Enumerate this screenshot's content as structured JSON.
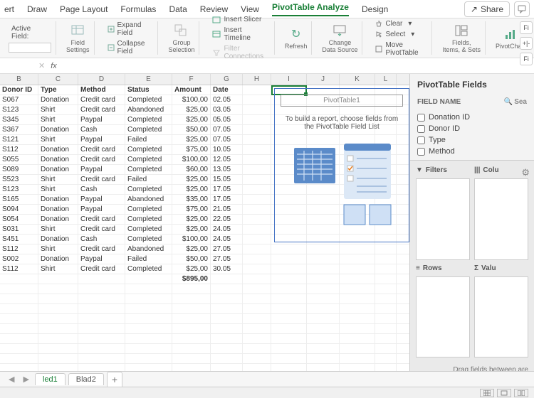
{
  "menu": {
    "items": [
      "ert",
      "Draw",
      "Page Layout",
      "Formulas",
      "Data",
      "Review",
      "View",
      "PivotTable Analyze",
      "Design"
    ],
    "active": "PivotTable Analyze",
    "share": "Share"
  },
  "ribbon": {
    "activeField": "Active Field:",
    "fieldSettings": "Field\nSettings",
    "expand": "Expand Field",
    "collapse": "Collapse Field",
    "groupSel": "Group\nSelection",
    "slicer": "Insert Slicer",
    "timeline": "Insert Timeline",
    "filterConn": "Filter Connections",
    "refresh": "Refresh",
    "changeData": "Change\nData Source",
    "clear": "Clear",
    "select": "Select",
    "move": "Move PivotTable",
    "fieldsItems": "Fields,\nItems, & Sets",
    "pivotChart": "PivotChart",
    "fi1": "Fi",
    "fi2": "Fi"
  },
  "formula": {
    "cell": "",
    "fx": "fx"
  },
  "columns": [
    "B",
    "C",
    "D",
    "E",
    "F",
    "G",
    "H",
    "I",
    "J",
    "K",
    "L"
  ],
  "header": [
    "Donor ID",
    "Type",
    "Method",
    "Status",
    "Amount",
    "Date"
  ],
  "rows": [
    [
      "S067",
      "Donation",
      "Credit card",
      "Completed",
      "$100,00",
      "02.05"
    ],
    [
      "S123",
      "Shirt",
      "Credit card",
      "Abandoned",
      "$25,00",
      "03.05"
    ],
    [
      "S345",
      "Shirt",
      "Paypal",
      "Completed",
      "$25,00",
      "05.05"
    ],
    [
      "S367",
      "Donation",
      "Cash",
      "Completed",
      "$50,00",
      "07.05"
    ],
    [
      "S121",
      "Shirt",
      "Paypal",
      "Failed",
      "$25,00",
      "07.05"
    ],
    [
      "S112",
      "Donation",
      "Credit card",
      "Completed",
      "$75,00",
      "10.05"
    ],
    [
      "S055",
      "Donation",
      "Credit card",
      "Completed",
      "$100,00",
      "12.05"
    ],
    [
      "S089",
      "Donation",
      "Paypal",
      "Completed",
      "$60,00",
      "13.05"
    ],
    [
      "S523",
      "Shirt",
      "Credit card",
      "Failed",
      "$25,00",
      "15.05"
    ],
    [
      "S123",
      "Shirt",
      "Cash",
      "Completed",
      "$25,00",
      "17.05"
    ],
    [
      "S165",
      "Donation",
      "Paypal",
      "Abandoned",
      "$35,00",
      "17.05"
    ],
    [
      "S094",
      "Donation",
      "Paypal",
      "Completed",
      "$75,00",
      "21.05"
    ],
    [
      "S054",
      "Donation",
      "Credit card",
      "Completed",
      "$25,00",
      "22.05"
    ],
    [
      "S031",
      "Shirt",
      "Credit card",
      "Completed",
      "$25,00",
      "24.05"
    ],
    [
      "S451",
      "Donation",
      "Cash",
      "Completed",
      "$100,00",
      "24.05"
    ],
    [
      "S112",
      "Shirt",
      "Credit card",
      "Abandoned",
      "$25,00",
      "27.05"
    ],
    [
      "S002",
      "Donation",
      "Paypal",
      "Failed",
      "$50,00",
      "27.05"
    ],
    [
      "S112",
      "Shirt",
      "Credit card",
      "Completed",
      "$25,00",
      "30.05"
    ]
  ],
  "total": "$895,00",
  "pivot": {
    "title": "PivotTable1",
    "msg": "To build a report, choose fields from the PivotTable Field List"
  },
  "fields": {
    "title": "PivotTable Fields",
    "sub": "FIELD NAME",
    "search": "Sea",
    "list": [
      "Donation ID",
      "Donor ID",
      "Type",
      "Method"
    ],
    "filters": "Filters",
    "cols": "Colu",
    "rowsL": "Rows",
    "vals": "Valu",
    "hint": "Drag fields between are"
  },
  "sheets": {
    "s1": "led1",
    "s2": "Blad2"
  },
  "icons": {
    "x": "✕",
    "chev": "▾",
    "gear": "⚙",
    "search": "🔍",
    "arrow": "↻",
    "plus": "+",
    "lt": "◀",
    "rt": "▶",
    "share": "↗",
    "filter": "▼",
    "grid3": "☷",
    "sigma": "Σ",
    "rows": "≡",
    "cols": "|||"
  }
}
